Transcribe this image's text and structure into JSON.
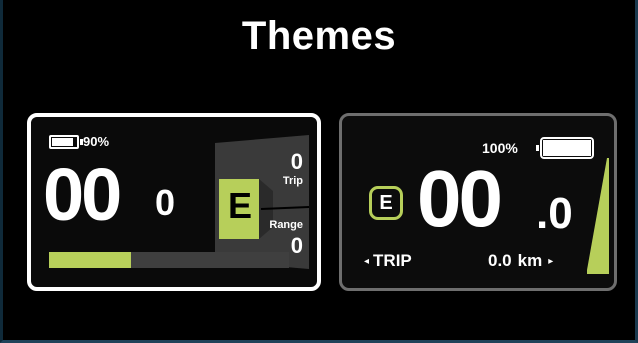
{
  "page": {
    "title": "Themes"
  },
  "colors": {
    "accent": "#b7cf5a",
    "background": "#000000",
    "selected_border": "#ffffff",
    "unselected_border": "#6e6e6e"
  },
  "themes": [
    {
      "battery": {
        "percent_label": "90%",
        "level": 0.9
      },
      "speed": {
        "integer": "00",
        "decimal": "0"
      },
      "assist_mode": "E",
      "trip": {
        "label": "Trip",
        "value": "0"
      },
      "range": {
        "label": "Range",
        "value": "0"
      },
      "assist_bar_level": 0.34,
      "selected": true
    },
    {
      "battery": {
        "percent_label": "100%",
        "level": 1.0
      },
      "speed": {
        "integer": "00",
        "decimal": ".0"
      },
      "assist_mode": "E",
      "trip": {
        "left_arrow": "◂",
        "label": "TRIP"
      },
      "distance": {
        "value": "0.0",
        "unit": "km",
        "right_arrow": "▸"
      },
      "selected": false
    }
  ]
}
